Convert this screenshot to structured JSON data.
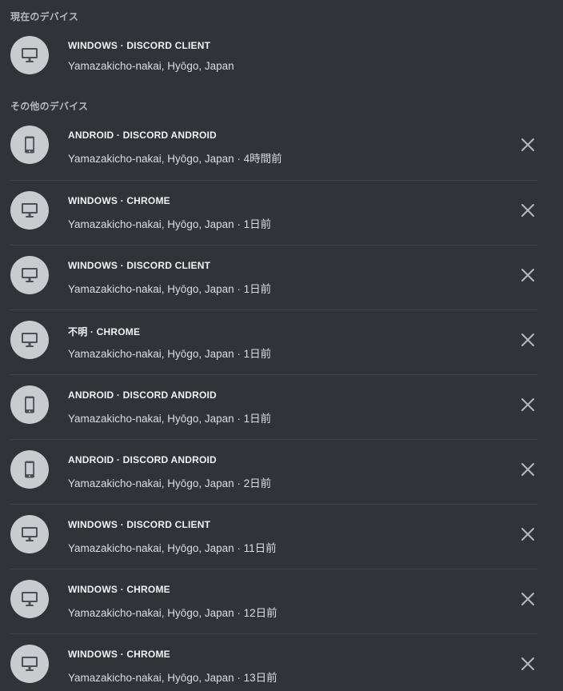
{
  "current_section": {
    "header": "現在のデバイス",
    "device": {
      "icon": "desktop-icon",
      "title": "WINDOWS · DISCORD CLIENT",
      "location": "Yamazakicho-nakai, Hyōgo, Japan"
    }
  },
  "other_section": {
    "header": "その他のデバイス",
    "devices": [
      {
        "icon": "mobile-phone-icon",
        "title": "ANDROID · DISCORD ANDROID",
        "location": "Yamazakicho-nakai, Hyōgo, Japan · 4時間前"
      },
      {
        "icon": "desktop-icon",
        "title": "WINDOWS · CHROME",
        "location": "Yamazakicho-nakai, Hyōgo, Japan · 1日前"
      },
      {
        "icon": "desktop-icon",
        "title": "WINDOWS · DISCORD CLIENT",
        "location": "Yamazakicho-nakai, Hyōgo, Japan · 1日前"
      },
      {
        "icon": "desktop-icon",
        "title": "不明 · CHROME",
        "location": "Yamazakicho-nakai, Hyōgo, Japan · 1日前"
      },
      {
        "icon": "mobile-phone-icon",
        "title": "ANDROID · DISCORD ANDROID",
        "location": "Yamazakicho-nakai, Hyōgo, Japan · 1日前"
      },
      {
        "icon": "mobile-phone-icon",
        "title": "ANDROID · DISCORD ANDROID",
        "location": "Yamazakicho-nakai, Hyōgo, Japan · 2日前"
      },
      {
        "icon": "desktop-icon",
        "title": "WINDOWS · DISCORD CLIENT",
        "location": "Yamazakicho-nakai, Hyōgo, Japan · 11日前"
      },
      {
        "icon": "desktop-icon",
        "title": "WINDOWS · CHROME",
        "location": "Yamazakicho-nakai, Hyōgo, Japan · 12日前"
      },
      {
        "icon": "desktop-icon",
        "title": "WINDOWS · CHROME",
        "location": "Yamazakicho-nakai, Hyōgo, Japan · 13日前"
      }
    ]
  },
  "colors": {
    "background": "#313338",
    "divider": "#3f4147",
    "avatar_bg": "#c9cbcf",
    "icon_fg": "#4e5058",
    "title": "#f2f3f5",
    "subtitle": "#dbdee1",
    "close_icon": "#b5bac1"
  }
}
